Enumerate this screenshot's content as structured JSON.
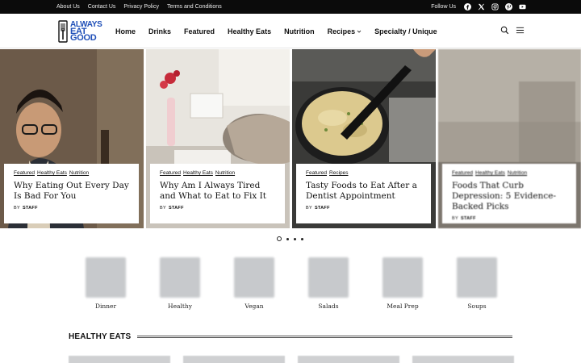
{
  "topbar": {
    "links": [
      "About Us",
      "Contact Us",
      "Privacy Policy",
      "Terms and Conditions"
    ],
    "follow_label": "Follow Us",
    "social_icons": [
      "facebook-icon",
      "x-icon",
      "instagram-icon",
      "pinterest-icon",
      "youtube-icon"
    ]
  },
  "logo": {
    "line1": "ALWAYS",
    "line2": "EAT",
    "line3": "GOOD"
  },
  "nav": {
    "items": [
      "Home",
      "Drinks",
      "Featured",
      "Healthy Eats",
      "Nutrition",
      "Recipes",
      "Specialty / Unique"
    ],
    "search_icon": "search-icon",
    "menu_icon": "hamburger-icon"
  },
  "slides": [
    {
      "tags": [
        "Featured",
        "Healthy Eats",
        "Nutrition"
      ],
      "title": "Why Eating Out Every Day Is Bad For You",
      "by": "BY",
      "author": "STAFF"
    },
    {
      "tags": [
        "Featured",
        "Healthy Eats",
        "Nutrition"
      ],
      "title": "Why Am I Always Tired and What to Eat to Fix It",
      "by": "BY",
      "author": "STAFF"
    },
    {
      "tags": [
        "Featured",
        "Recipes"
      ],
      "title": "Tasty Foods to Eat After a Dentist Appointment",
      "by": "BY",
      "author": "STAFF"
    },
    {
      "tags": [
        "Featured",
        "Healthy Eats",
        "Nutrition"
      ],
      "title": "Foods That Curb Depression: 5 Evidence-Backed Picks",
      "by": "BY",
      "author": "STAFF"
    }
  ],
  "categories": [
    "Dinner",
    "Healthy",
    "Vegan",
    "Salads",
    "Meal Prep",
    "Soups"
  ],
  "section": {
    "title": "HEALTHY EATS"
  },
  "colors": {
    "brand": "#1f4fb8",
    "topbar": "#0b0b0b"
  }
}
